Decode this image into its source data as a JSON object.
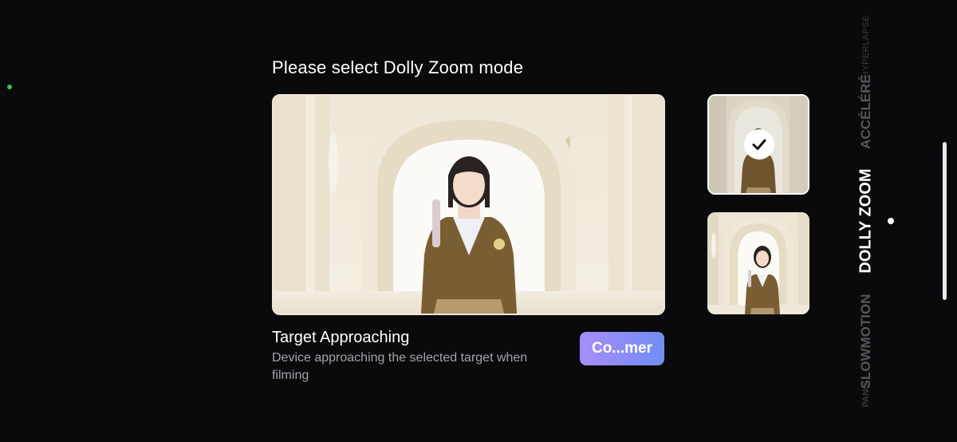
{
  "dialog": {
    "title": "Please select Dolly Zoom mode",
    "selected_mode": {
      "title": "Target Approaching",
      "description": "Device approaching the selected target when filming"
    },
    "start_button_label": "Co...mer",
    "options": [
      {
        "name": "target-approaching",
        "selected": true
      },
      {
        "name": "target-receding",
        "selected": false
      }
    ]
  },
  "mode_rail": {
    "items": [
      {
        "label": "HYPERLAPSE",
        "active": false
      },
      {
        "label": "ACCÉLÉRÉ",
        "active": false
      },
      {
        "label": "DOLLY ZOOM",
        "active": true
      },
      {
        "label": "SLOWMOTION",
        "active": false
      },
      {
        "label": "PANO",
        "active": false
      }
    ]
  },
  "colors": {
    "background": "#0a0a0c",
    "button_gradient_start": "#a98cf6",
    "button_gradient_end": "#6f8ef4",
    "status_dot": "#3cc24a",
    "active_text": "#ffffff",
    "inactive_text": "#4e4e52"
  },
  "icons": {
    "selected_check": "check-icon"
  }
}
